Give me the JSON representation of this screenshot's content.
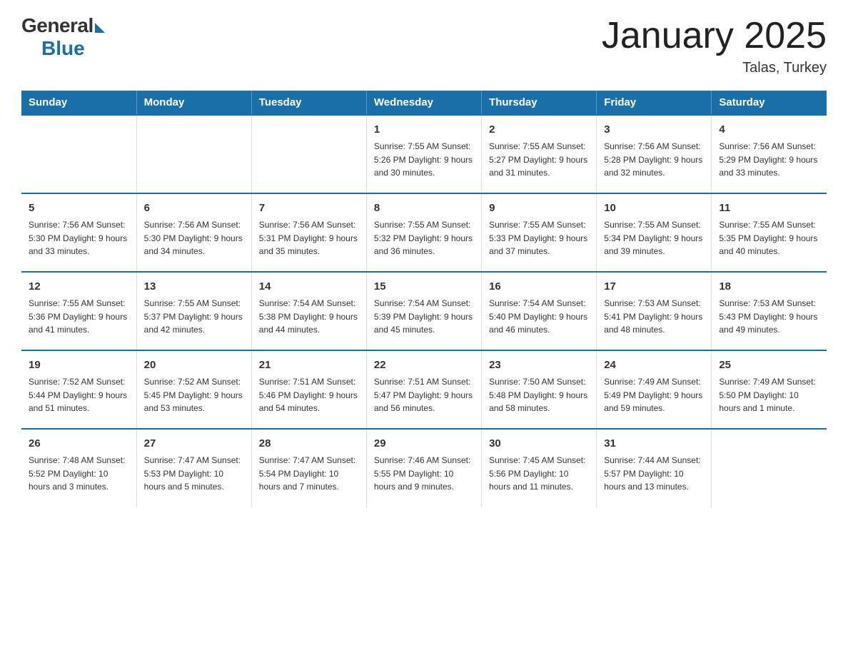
{
  "header": {
    "logo_general": "General",
    "logo_blue": "Blue",
    "title": "January 2025",
    "location": "Talas, Turkey"
  },
  "days_of_week": [
    "Sunday",
    "Monday",
    "Tuesday",
    "Wednesday",
    "Thursday",
    "Friday",
    "Saturday"
  ],
  "weeks": [
    [
      {
        "day": "",
        "info": ""
      },
      {
        "day": "",
        "info": ""
      },
      {
        "day": "",
        "info": ""
      },
      {
        "day": "1",
        "info": "Sunrise: 7:55 AM\nSunset: 5:26 PM\nDaylight: 9 hours\nand 30 minutes."
      },
      {
        "day": "2",
        "info": "Sunrise: 7:55 AM\nSunset: 5:27 PM\nDaylight: 9 hours\nand 31 minutes."
      },
      {
        "day": "3",
        "info": "Sunrise: 7:56 AM\nSunset: 5:28 PM\nDaylight: 9 hours\nand 32 minutes."
      },
      {
        "day": "4",
        "info": "Sunrise: 7:56 AM\nSunset: 5:29 PM\nDaylight: 9 hours\nand 33 minutes."
      }
    ],
    [
      {
        "day": "5",
        "info": "Sunrise: 7:56 AM\nSunset: 5:30 PM\nDaylight: 9 hours\nand 33 minutes."
      },
      {
        "day": "6",
        "info": "Sunrise: 7:56 AM\nSunset: 5:30 PM\nDaylight: 9 hours\nand 34 minutes."
      },
      {
        "day": "7",
        "info": "Sunrise: 7:56 AM\nSunset: 5:31 PM\nDaylight: 9 hours\nand 35 minutes."
      },
      {
        "day": "8",
        "info": "Sunrise: 7:55 AM\nSunset: 5:32 PM\nDaylight: 9 hours\nand 36 minutes."
      },
      {
        "day": "9",
        "info": "Sunrise: 7:55 AM\nSunset: 5:33 PM\nDaylight: 9 hours\nand 37 minutes."
      },
      {
        "day": "10",
        "info": "Sunrise: 7:55 AM\nSunset: 5:34 PM\nDaylight: 9 hours\nand 39 minutes."
      },
      {
        "day": "11",
        "info": "Sunrise: 7:55 AM\nSunset: 5:35 PM\nDaylight: 9 hours\nand 40 minutes."
      }
    ],
    [
      {
        "day": "12",
        "info": "Sunrise: 7:55 AM\nSunset: 5:36 PM\nDaylight: 9 hours\nand 41 minutes."
      },
      {
        "day": "13",
        "info": "Sunrise: 7:55 AM\nSunset: 5:37 PM\nDaylight: 9 hours\nand 42 minutes."
      },
      {
        "day": "14",
        "info": "Sunrise: 7:54 AM\nSunset: 5:38 PM\nDaylight: 9 hours\nand 44 minutes."
      },
      {
        "day": "15",
        "info": "Sunrise: 7:54 AM\nSunset: 5:39 PM\nDaylight: 9 hours\nand 45 minutes."
      },
      {
        "day": "16",
        "info": "Sunrise: 7:54 AM\nSunset: 5:40 PM\nDaylight: 9 hours\nand 46 minutes."
      },
      {
        "day": "17",
        "info": "Sunrise: 7:53 AM\nSunset: 5:41 PM\nDaylight: 9 hours\nand 48 minutes."
      },
      {
        "day": "18",
        "info": "Sunrise: 7:53 AM\nSunset: 5:43 PM\nDaylight: 9 hours\nand 49 minutes."
      }
    ],
    [
      {
        "day": "19",
        "info": "Sunrise: 7:52 AM\nSunset: 5:44 PM\nDaylight: 9 hours\nand 51 minutes."
      },
      {
        "day": "20",
        "info": "Sunrise: 7:52 AM\nSunset: 5:45 PM\nDaylight: 9 hours\nand 53 minutes."
      },
      {
        "day": "21",
        "info": "Sunrise: 7:51 AM\nSunset: 5:46 PM\nDaylight: 9 hours\nand 54 minutes."
      },
      {
        "day": "22",
        "info": "Sunrise: 7:51 AM\nSunset: 5:47 PM\nDaylight: 9 hours\nand 56 minutes."
      },
      {
        "day": "23",
        "info": "Sunrise: 7:50 AM\nSunset: 5:48 PM\nDaylight: 9 hours\nand 58 minutes."
      },
      {
        "day": "24",
        "info": "Sunrise: 7:49 AM\nSunset: 5:49 PM\nDaylight: 9 hours\nand 59 minutes."
      },
      {
        "day": "25",
        "info": "Sunrise: 7:49 AM\nSunset: 5:50 PM\nDaylight: 10 hours\nand 1 minute."
      }
    ],
    [
      {
        "day": "26",
        "info": "Sunrise: 7:48 AM\nSunset: 5:52 PM\nDaylight: 10 hours\nand 3 minutes."
      },
      {
        "day": "27",
        "info": "Sunrise: 7:47 AM\nSunset: 5:53 PM\nDaylight: 10 hours\nand 5 minutes."
      },
      {
        "day": "28",
        "info": "Sunrise: 7:47 AM\nSunset: 5:54 PM\nDaylight: 10 hours\nand 7 minutes."
      },
      {
        "day": "29",
        "info": "Sunrise: 7:46 AM\nSunset: 5:55 PM\nDaylight: 10 hours\nand 9 minutes."
      },
      {
        "day": "30",
        "info": "Sunrise: 7:45 AM\nSunset: 5:56 PM\nDaylight: 10 hours\nand 11 minutes."
      },
      {
        "day": "31",
        "info": "Sunrise: 7:44 AM\nSunset: 5:57 PM\nDaylight: 10 hours\nand 13 minutes."
      },
      {
        "day": "",
        "info": ""
      }
    ]
  ]
}
